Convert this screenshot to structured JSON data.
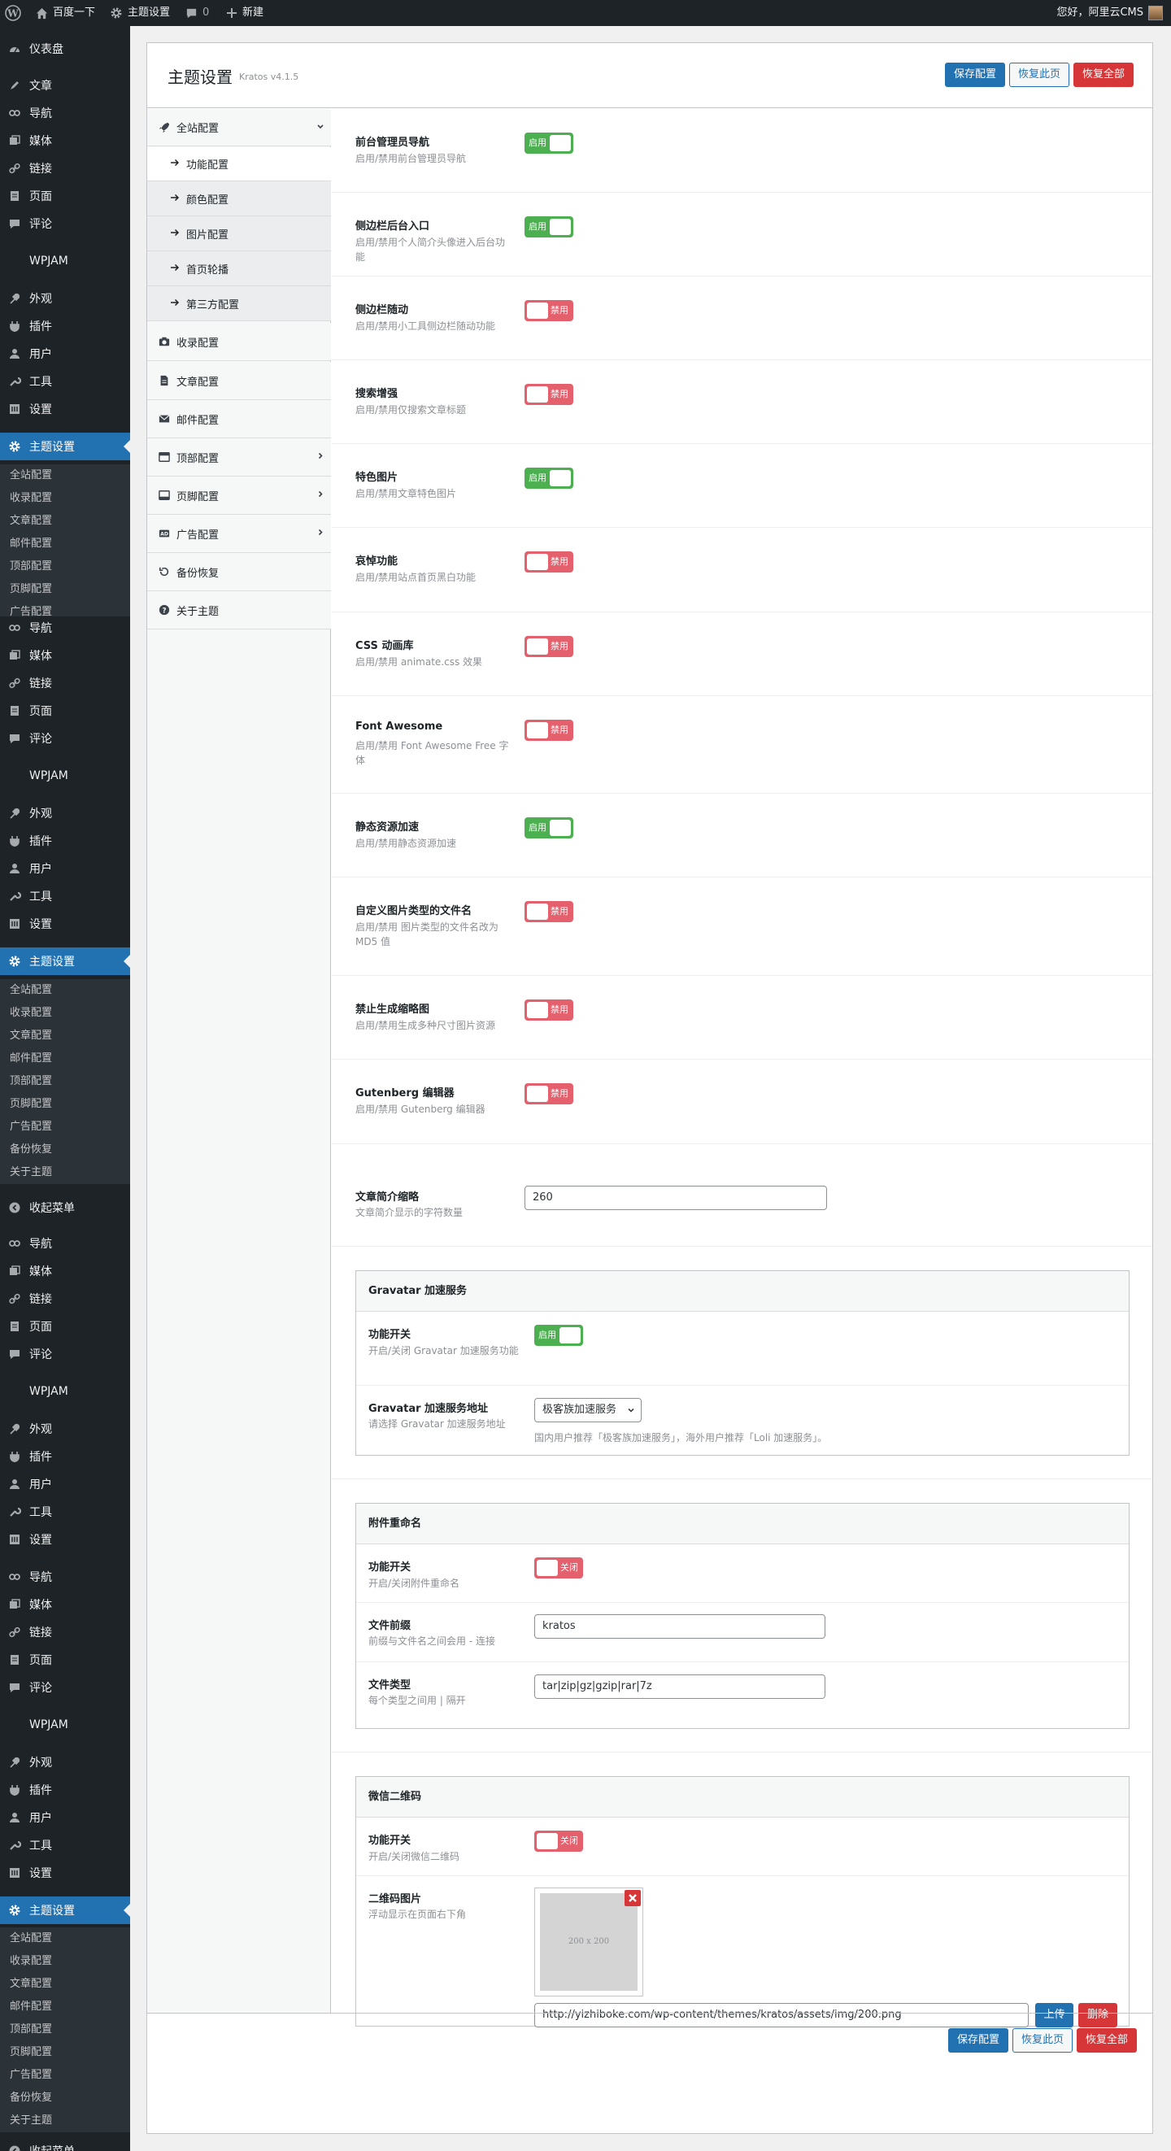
{
  "adminbar": {
    "home": "百度一下",
    "theme": "主题设置",
    "comments": "0",
    "new": "新建",
    "greeting": "您好，阿里云CMS"
  },
  "sidebar": {
    "dashboard": "仪表盘",
    "block_a": [
      "文章",
      "导航",
      "媒体",
      "链接",
      "页面",
      "评论"
    ],
    "block_b": [
      "导航",
      "媒体",
      "链接",
      "页面",
      "评论"
    ],
    "wpjam": "WPJAM",
    "block_c": [
      "外观",
      "插件",
      "用户",
      "工具",
      "设置"
    ],
    "theme_settings": "主题设置",
    "sub1": [
      "全站配置",
      "收录配置",
      "文章配置",
      "邮件配置",
      "顶部配置",
      "页脚配置",
      "广告配置"
    ],
    "sub2": [
      "全站配置",
      "收录配置",
      "文章配置",
      "邮件配置",
      "顶部配置",
      "页脚配置",
      "广告配置",
      "备份恢复",
      "关于主题"
    ],
    "collapse": "收起菜单"
  },
  "header": {
    "title": "主题设置",
    "version": "Kratos v4.1.5",
    "save": "保存配置",
    "reset_page": "恢复此页",
    "reset_all": "恢复全部"
  },
  "nav": {
    "group": "全站配置",
    "children": [
      "功能配置",
      "颜色配置",
      "图片配置",
      "首页轮播",
      "第三方配置"
    ],
    "items": [
      "收录配置",
      "文章配置",
      "邮件配置",
      "顶部配置",
      "页脚配置",
      "广告配置",
      "备份恢复",
      "关于主题"
    ]
  },
  "toggle_labels": {
    "on": "启用",
    "off": "禁用",
    "closed": "关闭"
  },
  "settings": [
    {
      "label": "前台管理员导航",
      "desc": "启用/禁用前台管理员导航",
      "on": true
    },
    {
      "label": "侧边栏后台入口",
      "desc": "启用/禁用个人简介头像进入后台功能",
      "on": true
    },
    {
      "label": "侧边栏随动",
      "desc": "启用/禁用小工具侧边栏随动功能",
      "on": false
    },
    {
      "label": "搜索增强",
      "desc": "启用/禁用仅搜索文章标题",
      "on": false
    },
    {
      "label": "特色图片",
      "desc": "启用/禁用文章特色图片",
      "on": true
    },
    {
      "label": "哀悼功能",
      "desc": "启用/禁用站点首页黑白功能",
      "on": false
    },
    {
      "label": "CSS 动画库",
      "desc": "启用/禁用 animate.css 效果",
      "on": false
    },
    {
      "label": "Font Awesome",
      "desc": "启用/禁用 Font Awesome Free 字体",
      "on": false
    },
    {
      "label": "静态资源加速",
      "desc": "启用/禁用静态资源加速",
      "on": true
    },
    {
      "label": "自定义图片类型的文件名",
      "desc": "启用/禁用 图片类型的文件名改为 MD5 值",
      "on": false
    },
    {
      "label": "禁止生成缩略图",
      "desc": "启用/禁用生成多种尺寸图片资源",
      "on": false
    },
    {
      "label": "Gutenberg 编辑器",
      "desc": "启用/禁用 Gutenberg 编辑器",
      "on": false
    }
  ],
  "excerpt": {
    "label": "文章简介缩略",
    "desc": "文章简介显示的字符数量",
    "value": "260"
  },
  "gravatar": {
    "title": "Gravatar 加速服务",
    "switch_label": "功能开关",
    "switch_desc": "开启/关闭 Gravatar 加速服务功能",
    "on": true,
    "addr_label": "Gravatar 加速服务地址",
    "addr_desc": "请选择 Gravatar 加速服务地址",
    "addr_value": "极客族加速服务",
    "addr_hint": "国内用户推荐「极客族加速服务」，海外用户推荐「Loli 加速服务」。"
  },
  "rename": {
    "title": "附件重命名",
    "switch_label": "功能开关",
    "switch_desc": "开启/关闭附件重命名",
    "on": false,
    "prefix_label": "文件前缀",
    "prefix_desc": "前缀与文件名之间会用 - 连接",
    "prefix_value": "kratos",
    "types_label": "文件类型",
    "types_desc": "每个类型之间用 | 隔开",
    "types_value": "tar|zip|gz|gzip|rar|7z"
  },
  "wechat": {
    "title": "微信二维码",
    "switch_label": "功能开关",
    "switch_desc": "开启/关闭微信二维码",
    "on": false,
    "img_label": "二维码图片",
    "img_desc": "浮动显示在页面右下角",
    "img_placeholder": "200 x 200",
    "url": "http://yizhiboke.com/wp-content/themes/kratos/assets/img/200.png",
    "upload": "上传",
    "remove": "删除"
  }
}
